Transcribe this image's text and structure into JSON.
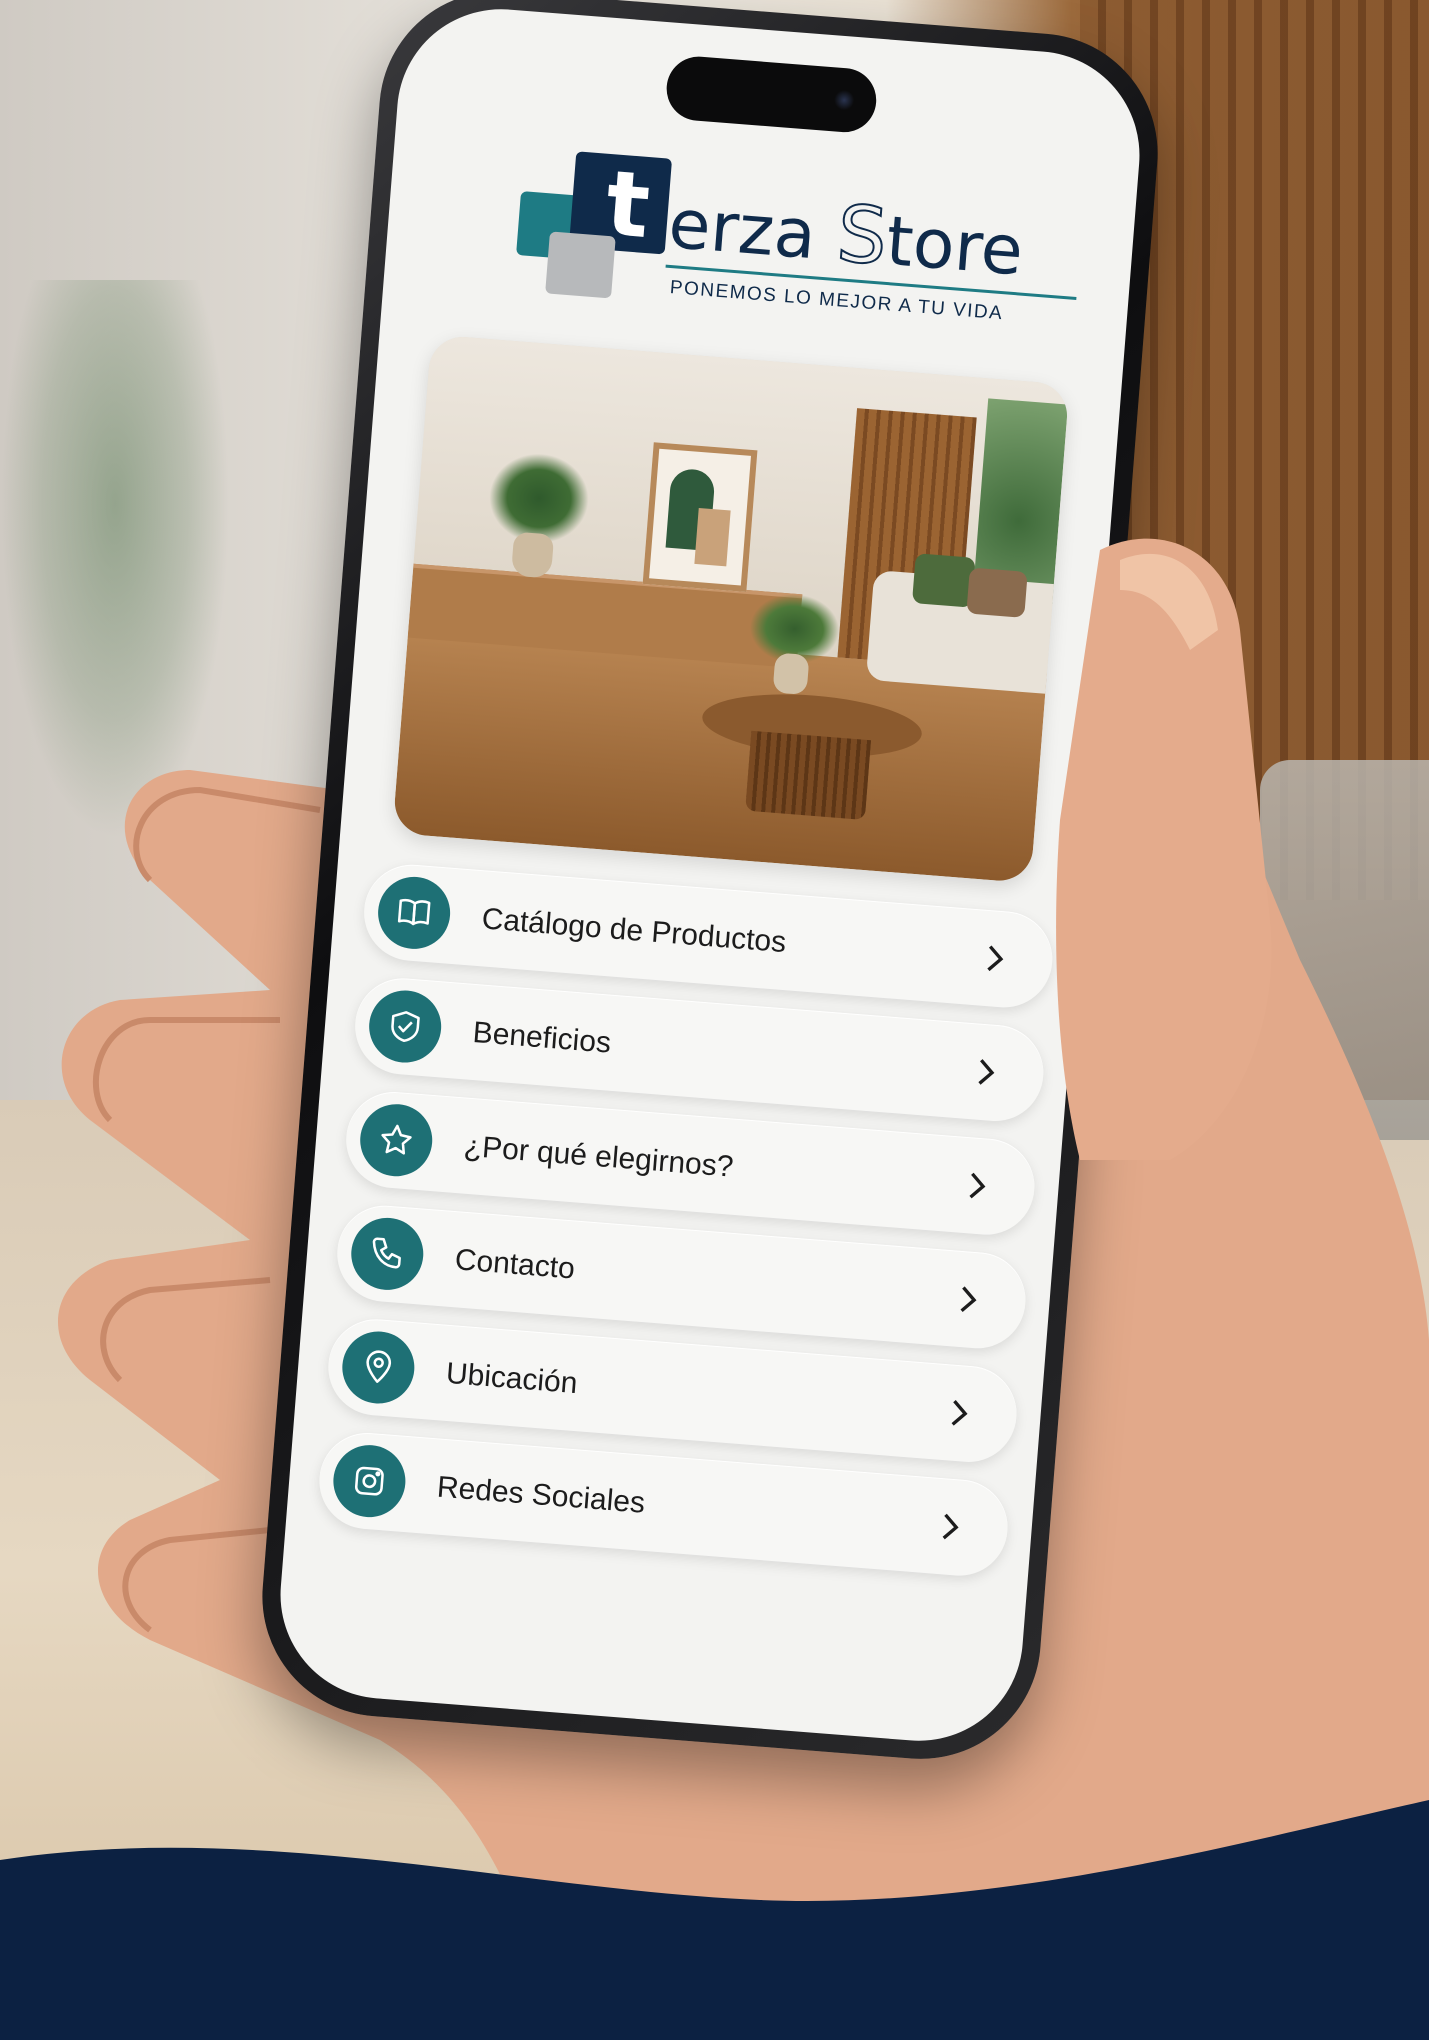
{
  "brand": {
    "letter": "t",
    "name_rest": "erza ",
    "name_s": "S",
    "name_end": "tore",
    "tagline": "PONEMOS LO MEJOR A TU VIDA",
    "colors": {
      "navy": "#0f2a4a",
      "teal": "#1e7b84",
      "grey": "#b7b9bb"
    }
  },
  "menu": {
    "items": [
      {
        "label": "Catálogo de Productos",
        "icon": "book-icon"
      },
      {
        "label": "Beneficios",
        "icon": "shield-check-icon"
      },
      {
        "label": "¿Por qué elegirnos?",
        "icon": "star-icon"
      },
      {
        "label": "Contacto",
        "icon": "phone-icon"
      },
      {
        "label": "Ubicación",
        "icon": "location-pin-icon"
      },
      {
        "label": "Redes Sociales",
        "icon": "instagram-icon"
      }
    ],
    "chevron_icon": "chevron-right-icon",
    "icon_color": "#1e7075"
  }
}
